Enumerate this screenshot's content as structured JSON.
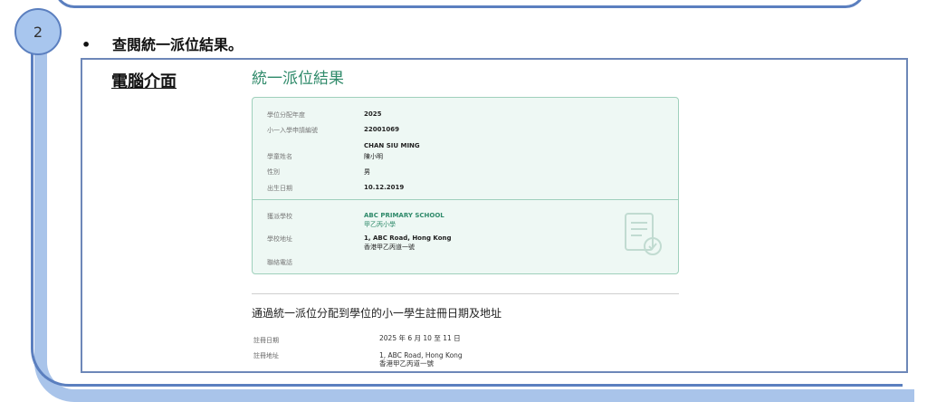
{
  "step": {
    "number": "2",
    "bullet": "•",
    "instruction": "查閱統一派位結果。"
  },
  "screenshot": {
    "label": "電腦介面",
    "title": "統一派位結果",
    "student": {
      "year_label": "學位分配年度",
      "year_value": "2025",
      "app_no_label": "小一入學申請編號",
      "app_no_value": "22001069",
      "name_label": "學童姓名",
      "name_en": "CHAN SIU MING",
      "name_zh": "陳小明",
      "gender_label": "性別",
      "gender_value": "男",
      "dob_label": "出生日期",
      "dob_value": "10.12.2019"
    },
    "school": {
      "school_label": "獲派學校",
      "school_name_en": "ABC PRIMARY SCHOOL",
      "school_name_zh": "甲乙丙小學",
      "address_label": "學校地址",
      "address_en": "1, ABC Road, Hong Kong",
      "address_zh": "香港甲乙丙道一號",
      "phone_label": "聯絡電話"
    },
    "registration": {
      "title": "通過統一派位分配到學位的小一學生註冊日期及地址",
      "date_label": "註冊日期",
      "date_value": "2025 年 6 月 10 至 11 日",
      "addr_label": "註冊地址",
      "addr_en": "1, ABC Road, Hong Kong",
      "addr_zh": "香港甲乙丙道一號"
    }
  },
  "colors": {
    "frame_blue": "#5b7fbf",
    "frame_light_blue": "#a9c4ea",
    "accent_green": "#2f8a6a",
    "card_bg": "#eef8f4"
  }
}
